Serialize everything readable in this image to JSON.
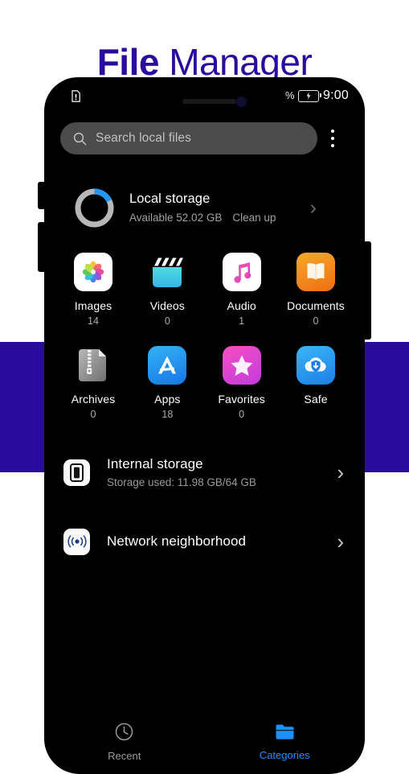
{
  "header": {
    "title_bold": "File",
    "title_light": "Manager",
    "title_color": "#2A0B9E"
  },
  "theme": {
    "band_color": "#2B0A9E",
    "phone_bg": "#000000",
    "accent_blue": "#1f8fff",
    "search_bg": "#4b4b4b"
  },
  "status_bar": {
    "sim_icon": "document-sim-icon",
    "battery_percent_symbol": "%",
    "battery_icon": "battery-charging-icon",
    "time": "9:00"
  },
  "search": {
    "icon": "search-icon",
    "placeholder": "Search local files",
    "overflow_icon": "kebab-menu-icon"
  },
  "local_storage": {
    "icon": "storage-donut-chart",
    "title": "Local storage",
    "available": "Available 52.02 GB",
    "clean_up": "Clean up",
    "chevron": "chevron-right-icon",
    "used_percent": 19
  },
  "categories": [
    {
      "label": "Images",
      "count": "14",
      "icon": "photos-flower-icon"
    },
    {
      "label": "Videos",
      "count": "0",
      "icon": "clapperboard-icon"
    },
    {
      "label": "Audio",
      "count": "1",
      "icon": "music-note-icon"
    },
    {
      "label": "Documents",
      "count": "0",
      "icon": "open-book-icon"
    },
    {
      "label": "Archives",
      "count": "0",
      "icon": "zip-file-icon"
    },
    {
      "label": "Apps",
      "count": "18",
      "icon": "app-store-icon"
    },
    {
      "label": "Favorites",
      "count": "0",
      "icon": "star-icon"
    },
    {
      "label": "Safe",
      "count": "",
      "icon": "cloud-shield-icon"
    }
  ],
  "storage_rows": [
    {
      "title": "Internal storage",
      "subtitle": "Storage used: 11.98 GB/64 GB",
      "icon": "phone-icon",
      "chevron": "chevron-right-icon"
    },
    {
      "title": "Network neighborhood",
      "subtitle": "",
      "icon": "broadcast-icon",
      "chevron": "chevron-right-icon"
    }
  ],
  "bottom_nav": [
    {
      "label": "Recent",
      "icon": "clock-icon",
      "active": false
    },
    {
      "label": "Categories",
      "icon": "folder-icon",
      "active": true
    }
  ]
}
